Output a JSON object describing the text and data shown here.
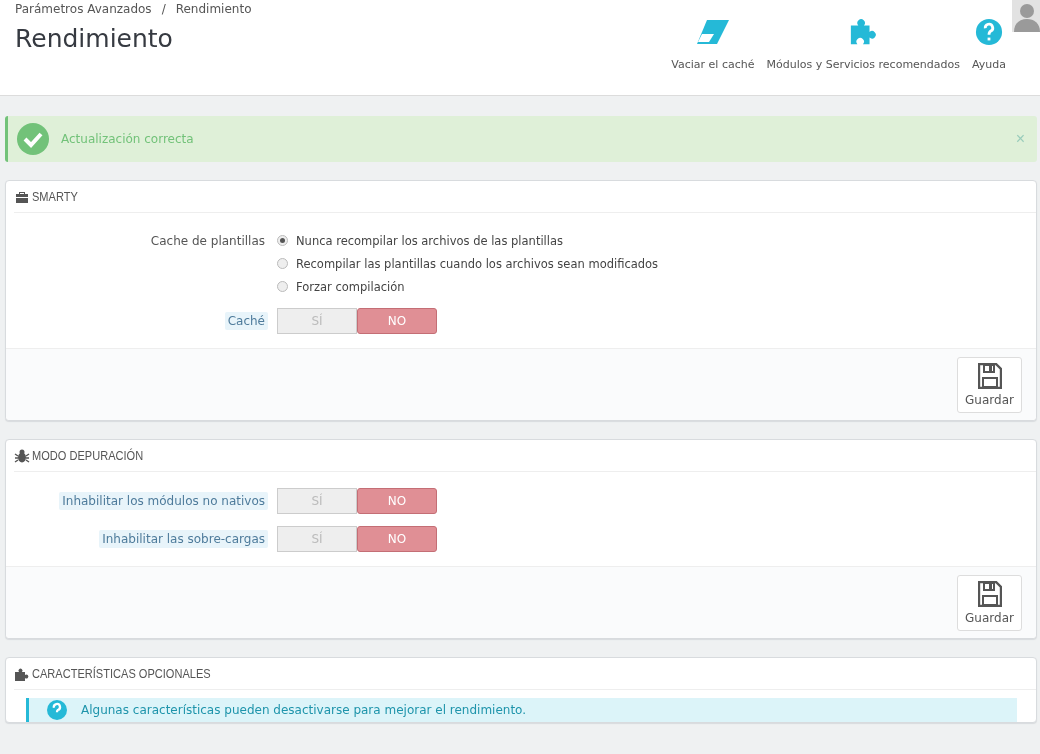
{
  "breadcrumb": [
    "Parámetros Avanzados",
    "Rendimiento"
  ],
  "breadcrumb_separator": "/",
  "title": "Rendimiento",
  "toolbar": [
    {
      "kind": "eraser",
      "label": "Vaciar el caché"
    },
    {
      "kind": "puzzle",
      "label": "Módulos y Servicios recomendados"
    },
    {
      "kind": "help",
      "label": "Ayuda"
    }
  ],
  "alert": {
    "text": "Actualización correcta",
    "close": "×"
  },
  "panels": [
    {
      "title": "SMARTY",
      "rows": [
        {
          "kind": "radio",
          "label": "Cache de plantillas",
          "has_help": false,
          "options": [
            {
              "label": "Nunca recompilar los archivos de las plantillas",
              "selected": true
            },
            {
              "label": "Recompilar las plantillas cuando los archivos sean modificados",
              "selected": false
            },
            {
              "label": "Forzar compilación",
              "selected": false
            }
          ]
        },
        {
          "kind": "switch",
          "label": "Caché",
          "has_help": true,
          "options": [
            {
              "label": "SÍ",
              "selected": false
            },
            {
              "label": "NO",
              "selected": true
            }
          ]
        }
      ],
      "save": "Guardar"
    },
    {
      "title": "MODO DEPURACIÓN",
      "rows": [
        {
          "kind": "switch",
          "label": "Inhabilitar los módulos no nativos",
          "has_help": true,
          "options": [
            {
              "label": "SÍ",
              "selected": false
            },
            {
              "label": "NO",
              "selected": true
            }
          ]
        },
        {
          "kind": "switch",
          "label": "Inhabilitar las sobre-cargas",
          "has_help": true,
          "options": [
            {
              "label": "SÍ",
              "selected": false
            },
            {
              "label": "NO",
              "selected": true
            }
          ]
        }
      ],
      "save": "Guardar"
    },
    {
      "title": "CARACTERÍSTICAS OPCIONALES",
      "info": "Algunas características pueden desactivarse para mejorar el rendimiento."
    }
  ]
}
